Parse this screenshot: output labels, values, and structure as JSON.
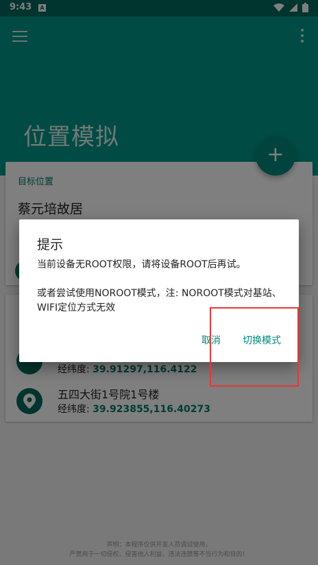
{
  "status_bar": {
    "time": "9:43",
    "notification_glyph": "A"
  },
  "app": {
    "title": "位置模拟"
  },
  "target_card": {
    "label": "目标位置",
    "place_name": "蔡元培故居"
  },
  "history": {
    "items": [
      {
        "name": "",
        "coord_label": "经纬度:",
        "coord_value": "39.91297,116.4122"
      },
      {
        "name": "五四大街1号院1号楼",
        "coord_label": "经纬度:",
        "coord_value": "39.923855,116.40273"
      }
    ]
  },
  "footer": {
    "line1": "声明：本程序仅供开发人员调试使用，",
    "line2": "严禁用于一切侵权、侵害他人利益、违法违禁等不当行为和目的！"
  },
  "dialog": {
    "title": "提示",
    "message_line1": "当前设备无ROOT权限，请将设备ROOT后再试。",
    "message_line2": "或者尝试使用NOROOT模式，注: NOROOT模式对基站、WIFI定位方式无效",
    "cancel_label": "取消",
    "switch_label": "切换模式"
  },
  "colors": {
    "primary": "#009688",
    "primary_dark": "#00695c",
    "accent": "#00897b",
    "highlight": "#e53935"
  }
}
